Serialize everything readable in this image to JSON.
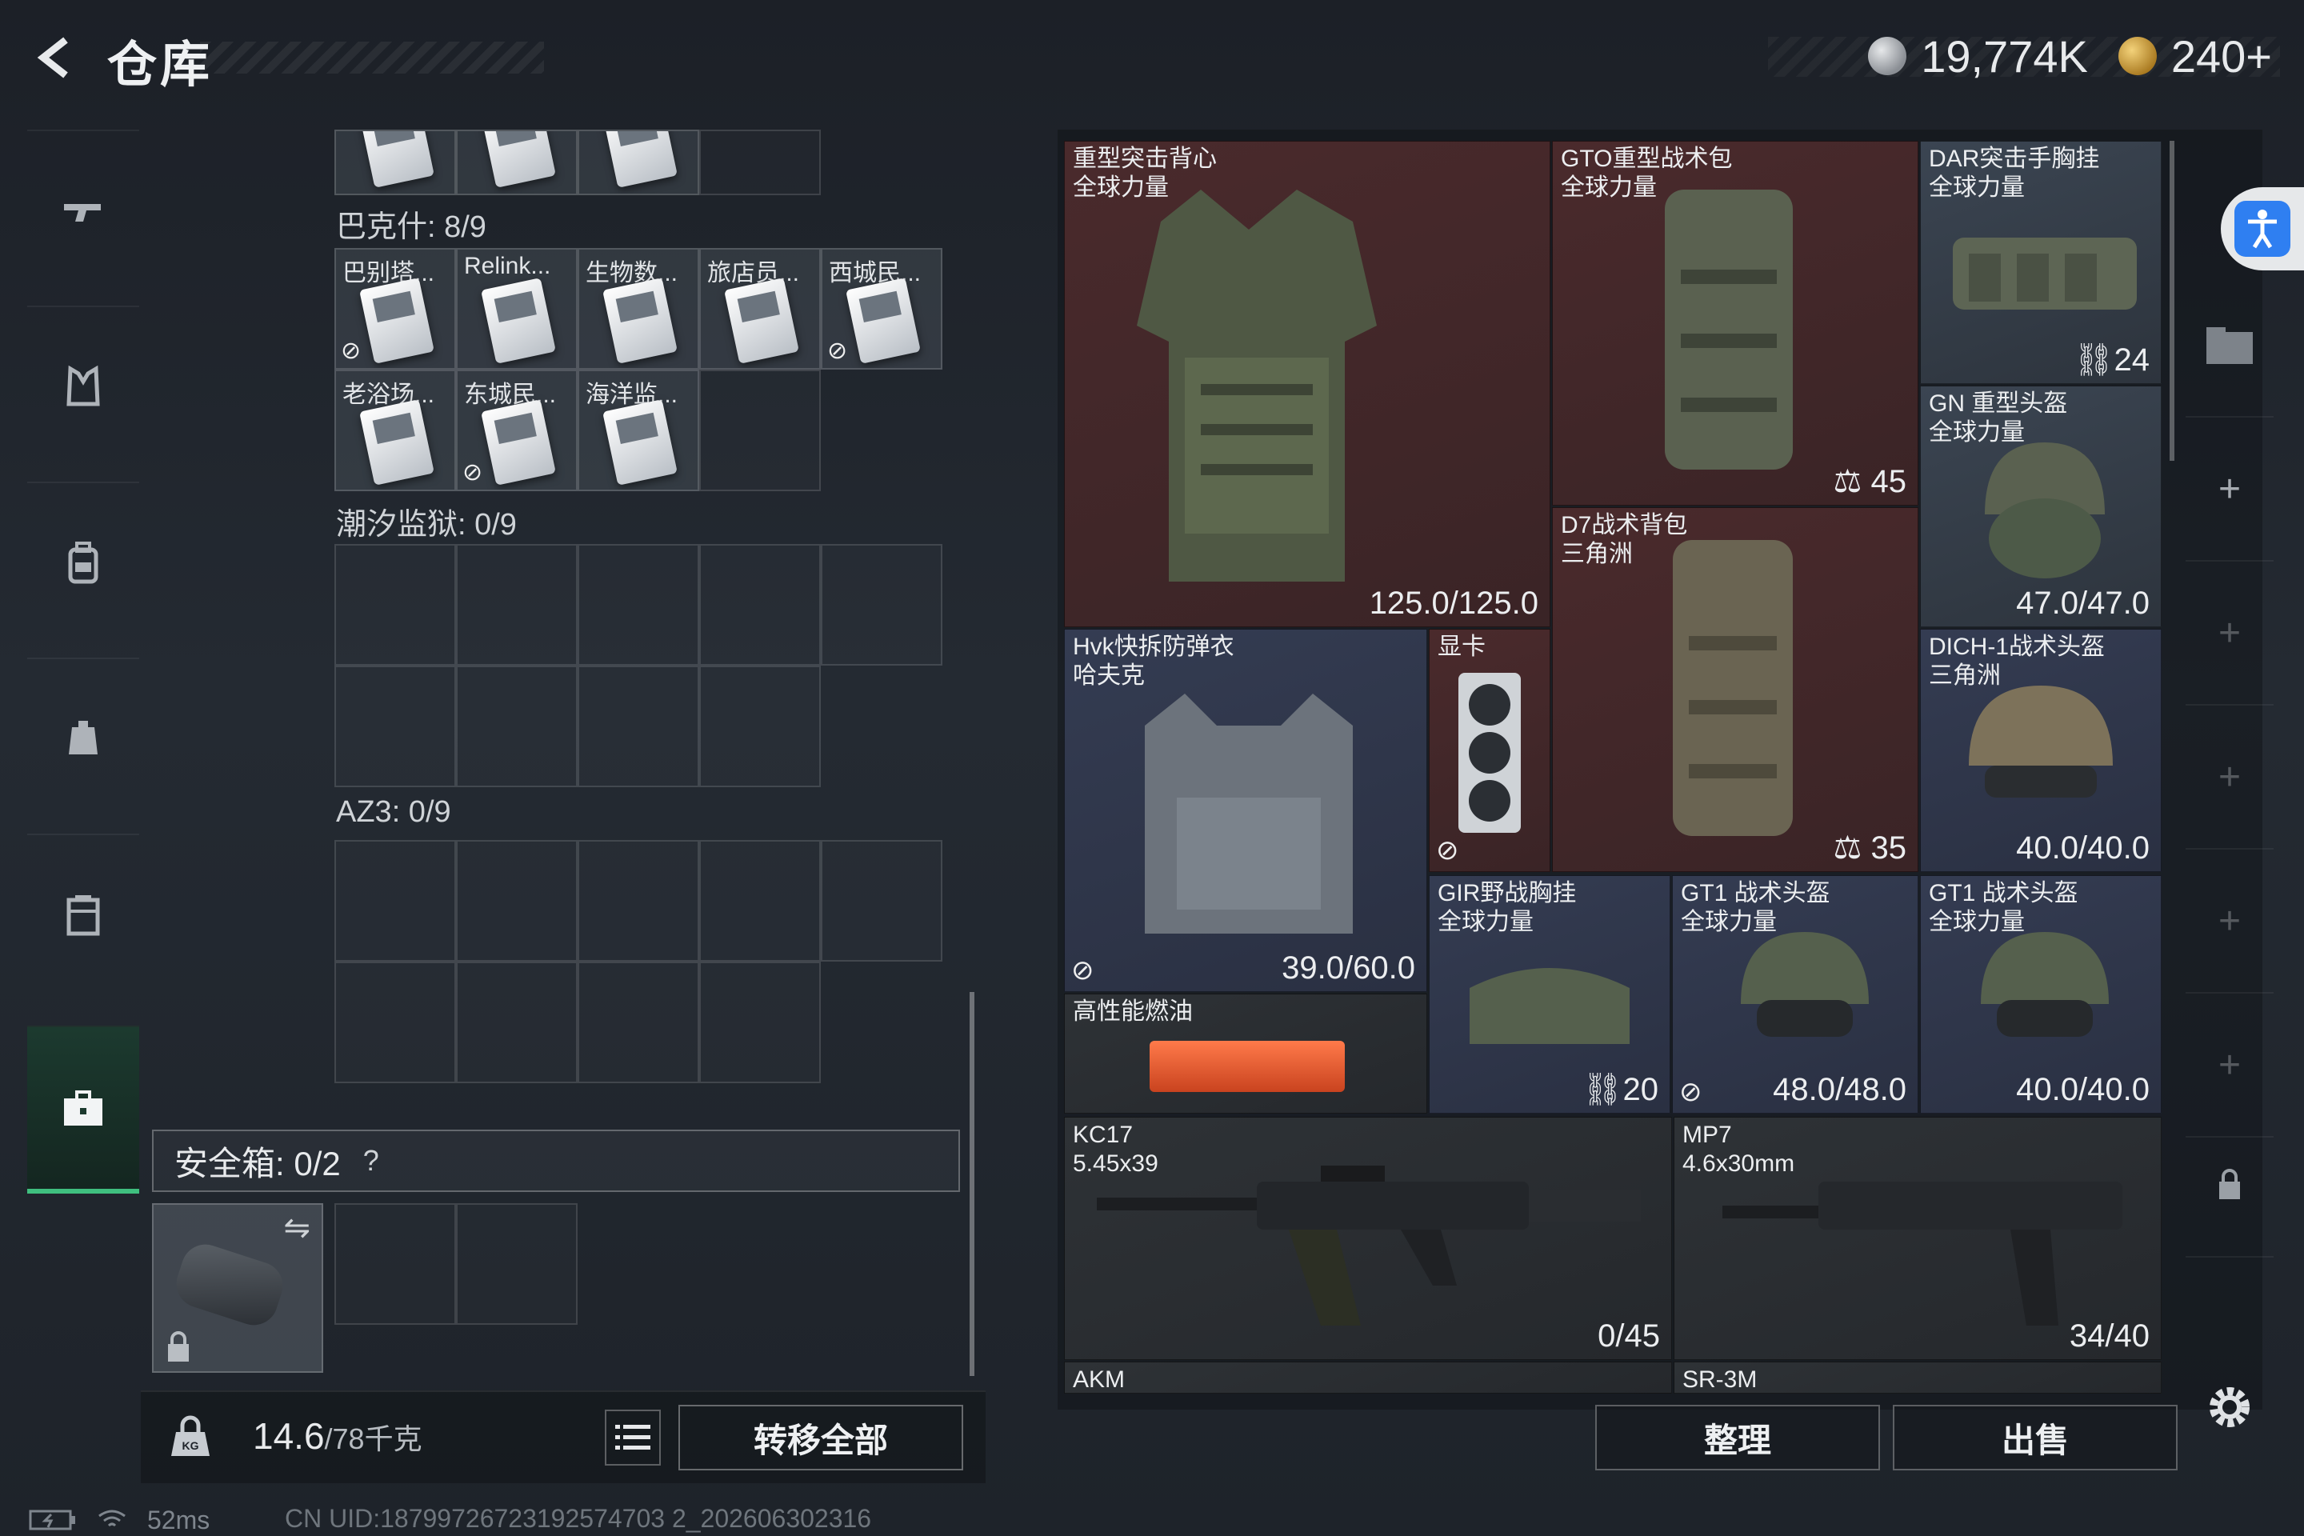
{
  "header": {
    "title": "仓库",
    "currency": [
      {
        "icon": "silver-coin-icon",
        "value": "19,774K"
      },
      {
        "icon": "gold-coin-icon",
        "value": "240+"
      }
    ]
  },
  "left_nav": {
    "items": [
      {
        "name": "weapons",
        "icon": "gun-icon"
      },
      {
        "name": "armor",
        "icon": "armor-vest-icon"
      },
      {
        "name": "backpack",
        "icon": "backpack-icon"
      },
      {
        "name": "chest-rig",
        "icon": "chest-rig-icon"
      },
      {
        "name": "keycard-box",
        "icon": "keycard-box-icon"
      },
      {
        "name": "briefcase",
        "icon": "briefcase-icon",
        "active": true
      }
    ]
  },
  "key_sections": [
    {
      "label": "巴克什: 8/9",
      "items": [
        "巴别塔...",
        "Relink...",
        "生物数...",
        "旅店员...",
        "西城民...",
        "老浴场...",
        "东城民...",
        "海洋监...",
        ""
      ],
      "no_link": [
        true,
        false,
        false,
        false,
        true,
        false,
        true,
        false,
        false
      ]
    },
    {
      "label": "潮汐监狱: 0/9"
    },
    {
      "label": "AZ3: 0/9"
    }
  ],
  "safebox": {
    "label": "安全箱: 0/2",
    "help": "?"
  },
  "footer_left": {
    "weight_current": "14.6",
    "weight_max": "/78",
    "weight_unit": "千克",
    "transfer_label": "转移全部"
  },
  "stash_items": {
    "heavy_vest": {
      "name": "重型突击背心",
      "sub": "全球力量",
      "durability": "125.0/125.0"
    },
    "gto_bag": {
      "name": "GTO重型战术包",
      "sub": "全球力量",
      "capacity": "45"
    },
    "dar_rig": {
      "name": "DAR突击手胸挂",
      "sub": "全球力量",
      "capacity": "24"
    },
    "gn_helmet": {
      "name": "GN 重型头盔",
      "sub": "全球力量",
      "durability": "47.0/47.0"
    },
    "d7_bag": {
      "name": "D7战术背包",
      "sub": "三角洲",
      "capacity": "35"
    },
    "hvk_vest": {
      "name": "Hvk快拆防弹衣",
      "sub": "哈夫克",
      "durability": "39.0/60.0"
    },
    "gpu": {
      "name": "显卡"
    },
    "dich_helmet": {
      "name": "DICH-1战术头盔",
      "sub": "三角洲",
      "durability": "40.0/40.0"
    },
    "fuel": {
      "name": "高性能燃油"
    },
    "gir_rig": {
      "name": "GIR野战胸挂",
      "sub": "全球力量",
      "capacity": "20"
    },
    "gt1_helmet_a": {
      "name": "GT1 战术头盔",
      "sub": "全球力量",
      "durability": "48.0/48.0"
    },
    "gt1_helmet_b": {
      "name": "GT1 战术头盔",
      "sub": "全球力量",
      "durability": "40.0/40.0"
    },
    "kc17": {
      "name": "KC17",
      "sub": "5.45x39",
      "ammo": "0/45"
    },
    "mp7": {
      "name": "MP7",
      "sub": "4.6x30mm",
      "ammo": "34/40"
    },
    "akm": {
      "name": "AKM"
    },
    "sr3m": {
      "name": "SR-3M"
    }
  },
  "footer_right": {
    "sort_label": "整理",
    "sell_label": "出售"
  },
  "status": {
    "ping": "52ms",
    "uid": "CN UID:18799726723192574703 2_202606302316"
  },
  "colors": {
    "accent_green": "#3fbf7f",
    "red_slot": "#4a2a2c",
    "blue_slot": "#343c52",
    "accessibility_blue": "#2f7ff1"
  }
}
